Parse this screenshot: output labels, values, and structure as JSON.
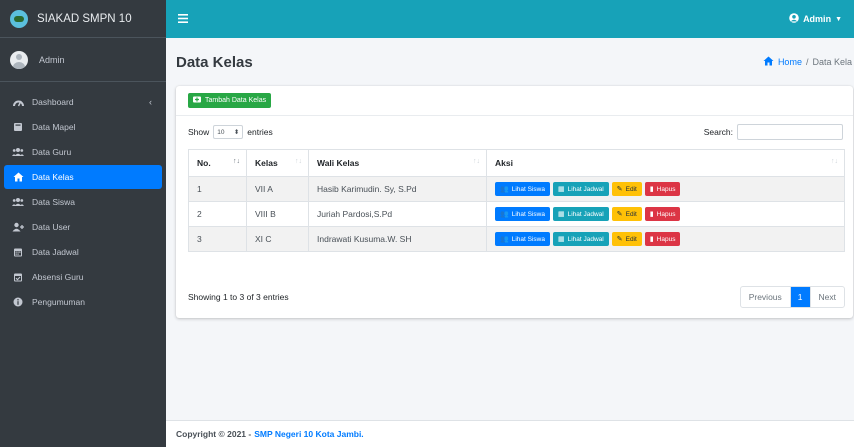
{
  "app": {
    "title": "SIAKAD SMPN 10"
  },
  "sidebar": {
    "user": "Admin",
    "items": [
      {
        "label": "Dashboard",
        "icon": "tachometer-icon"
      },
      {
        "label": "Data Mapel",
        "icon": "book-icon"
      },
      {
        "label": "Data Guru",
        "icon": "users-icon"
      },
      {
        "label": "Data Kelas",
        "icon": "home-icon",
        "active": true
      },
      {
        "label": "Data Siswa",
        "icon": "users-icon"
      },
      {
        "label": "Data User",
        "icon": "user-plus-icon"
      },
      {
        "label": "Data Jadwal",
        "icon": "calendar-icon"
      },
      {
        "label": "Absensi Guru",
        "icon": "calendar-check-icon"
      },
      {
        "label": "Pengumuman",
        "icon": "info-icon"
      }
    ]
  },
  "topbar": {
    "user_label": "Admin"
  },
  "page": {
    "title": "Data Kelas",
    "breadcrumb_home": "Home",
    "breadcrumb_sep": "/",
    "breadcrumb_current": "Data Kela"
  },
  "card": {
    "add_button": "Tambah Data Kelas",
    "show_label": "Show",
    "entries_value": "10",
    "entries_label": "entries",
    "search_label": "Search:",
    "columns": [
      "No.",
      "Kelas",
      "Wali Kelas",
      "Aksi"
    ],
    "rows": [
      {
        "no": "1",
        "kelas": "VII A",
        "wali": "Hasib Karimudin. Sy, S.Pd"
      },
      {
        "no": "2",
        "kelas": "VIII B",
        "wali": "Juriah Pardosi,S.Pd"
      },
      {
        "no": "3",
        "kelas": "XI C",
        "wali": "Indrawati Kusuma.W. SH"
      }
    ],
    "actions": {
      "lihat_siswa": "Lihat Siswa",
      "lihat_jadwal": "Lihat Jadwal",
      "edit": "Edit",
      "hapus": "Hapus"
    },
    "info": "Showing 1 to 3 of 3 entries",
    "pagination": {
      "previous": "Previous",
      "current": "1",
      "next": "Next"
    }
  },
  "footer": {
    "prefix": "Copyright © 2021 -",
    "link": "SMP Negeri 10 Kota Jambi."
  },
  "colors": {
    "sidebar": "#343a40",
    "topbar": "#17a2b8",
    "primary": "#007bff",
    "success": "#28a745",
    "warning": "#ffc107",
    "danger": "#dc3545"
  }
}
